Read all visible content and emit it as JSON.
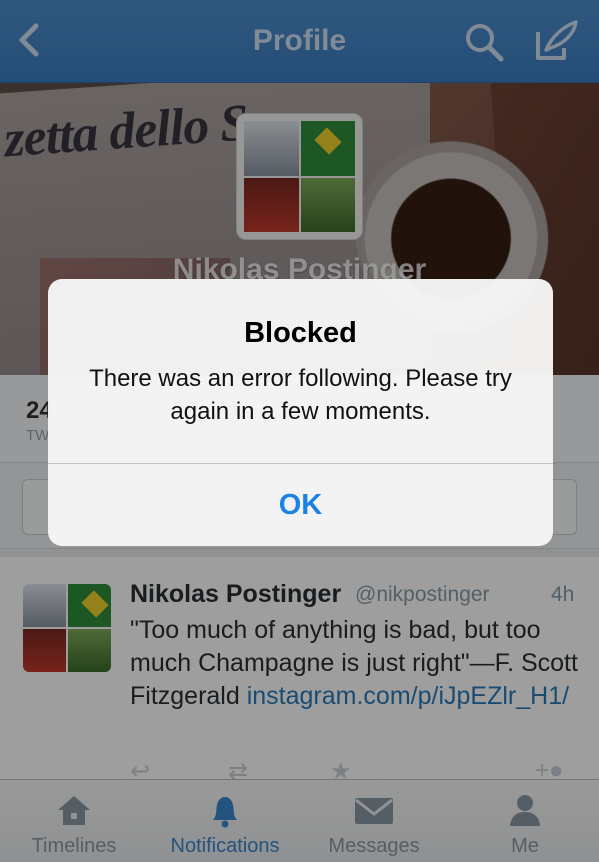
{
  "navbar": {
    "title": "Profile",
    "back_icon": "chevron-left-icon",
    "search_icon": "search-icon",
    "compose_icon": "compose-icon"
  },
  "header": {
    "banner_text": "zetta dello Sp",
    "display_name": "Nikolas Postinger"
  },
  "stats": {
    "count": "24",
    "label": "TW"
  },
  "tweet": {
    "name": "Nikolas Postinger",
    "handle": "@nikpostinger",
    "time": "4h",
    "text": "\"Too much of anything is bad, but too much Champagne is just right\"—F. Scott Fitzgerald ",
    "link": "instagram.com/p/iJpEZlr_H1/"
  },
  "tabbar": {
    "items": [
      {
        "label": "Timelines",
        "icon": "home-icon"
      },
      {
        "label": "Notifications",
        "icon": "bell-icon"
      },
      {
        "label": "Messages",
        "icon": "envelope-icon"
      },
      {
        "label": "Me",
        "icon": "person-icon"
      }
    ],
    "active_index": 1
  },
  "alert": {
    "title": "Blocked",
    "message": "There was an error following. Please try again in a few moments.",
    "ok_label": "OK"
  },
  "colors": {
    "navbar": "#3b7cc0",
    "accent": "#1a82e4",
    "link": "#2b7bb9"
  }
}
